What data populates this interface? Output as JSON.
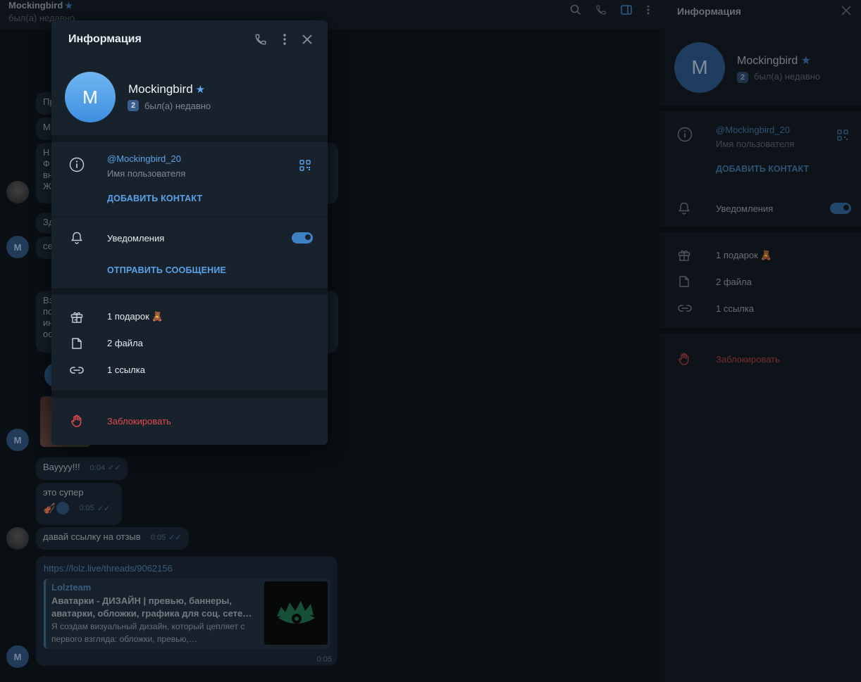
{
  "chat": {
    "title": "Mockingbird",
    "star": "★",
    "status": "был(а) недавно",
    "messages": [
      {
        "text": "Вауууу!!!",
        "time": "0:04",
        "checks": "✓✓"
      },
      {
        "text": "это супер",
        "time": "0:05",
        "checks": "✓✓"
      },
      {
        "text": "давай ссылку на отзыв",
        "time": "0:05",
        "checks": "✓✓"
      }
    ],
    "partial_text": [
      "Пр",
      "М",
      "Н",
      "Ф",
      "вн",
      "Ж",
      "Зд",
      "се",
      "Вз",
      "по",
      "ин",
      "ос"
    ],
    "link_preview": {
      "url": "https://lolz.live/threads/9062156",
      "site": "Lolzteam",
      "title": "Аватарки - ДИЗАЙН | превью, баннеры, аватарки, обложки, графика для соц. сете…",
      "description": "Я создам визуальный дизайн, который цепляет с первого взгляда: обложки, превью,…",
      "time": "0:05"
    },
    "avatar_letter": "M"
  },
  "side_panel": {
    "title": "Информация",
    "name": "Mockingbird",
    "star": "★",
    "badge": "2",
    "status": "был(а) недавно",
    "avatar_letter": "M",
    "username": "@Mockingbird_20",
    "username_label": "Имя пользователя",
    "add_contact": "ДОБАВИТЬ КОНТАКТ",
    "notifications": "Уведомления",
    "gifts": "1 подарок 🧸",
    "files": "2 файла",
    "links": "1 ссылка",
    "block": "Заблокировать"
  },
  "modal": {
    "title": "Информация",
    "avatar_letter": "M",
    "name": "Mockingbird",
    "star": "★",
    "badge": "2",
    "status": "был(а) недавно",
    "username": "@Mockingbird_20",
    "username_label": "Имя пользователя",
    "add_contact": "ДОБАВИТЬ КОНТАКТ",
    "notifications": "Уведомления",
    "notifications_on": true,
    "send_message": "ОТПРАВИТЬ СООБЩЕНИЕ",
    "gifts": "1 подарок 🧸",
    "files": "2 файла",
    "links": "1 ссылка",
    "block": "Заблокировать"
  },
  "colors": {
    "accent": "#5aa2e8",
    "danger": "#e5484d",
    "modal_bg": "#18222d",
    "avatar": "#4a9be8"
  },
  "icons": [
    "search-icon",
    "phone-icon",
    "sidebar-toggle-icon",
    "more-icon",
    "close-icon",
    "info-icon",
    "qr-code-icon",
    "bell-icon",
    "gift-icon",
    "file-icon",
    "link-icon",
    "hand-stop-icon"
  ]
}
